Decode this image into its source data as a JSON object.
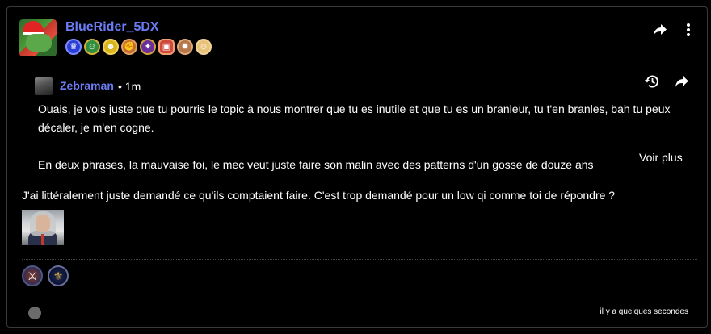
{
  "post": {
    "author": "BlueRider_5DX",
    "badges": [
      {
        "icon": "crown-icon",
        "glyph": "♛"
      },
      {
        "icon": "elf-icon",
        "glyph": "☺"
      },
      {
        "icon": "smiley-icon",
        "glyph": "☻"
      },
      {
        "icon": "brawler-icon",
        "glyph": "✊"
      },
      {
        "icon": "dragon-icon",
        "glyph": "✦"
      },
      {
        "icon": "scroll-icon",
        "glyph": "▣"
      },
      {
        "icon": "sun-icon",
        "glyph": "✹"
      },
      {
        "icon": "baby-icon",
        "glyph": "☺"
      }
    ],
    "message": "J'ai littéralement juste demandé ce qu'ils comptaient faire. C'est trop demandé pour un low qi comme toi de répondre ?",
    "timestamp": "il y a quelques secondes"
  },
  "quote": {
    "author": "Zebraman",
    "time": "• 1m",
    "paragraph1": "Ouais, je vois juste que tu pourris le topic à nous montrer que tu es inutile et que tu es un branleur, tu t'en branles, bah tu peux décaler, je m'en cogne.",
    "paragraph2": "En deux phrases, la mauvaise foi, le mec veut juste faire son malin avec des patterns d'un gosse de douze ans",
    "see_more": "Voir plus"
  },
  "reactions": [
    {
      "icon": "warrior-reaction-icon",
      "glyph": "⚔"
    },
    {
      "icon": "fleur-de-lis-reaction-icon",
      "glyph": "⚜"
    }
  ],
  "colors": {
    "username": "#6c7cf5",
    "background": "#000000",
    "border": "#3a3a3a"
  }
}
